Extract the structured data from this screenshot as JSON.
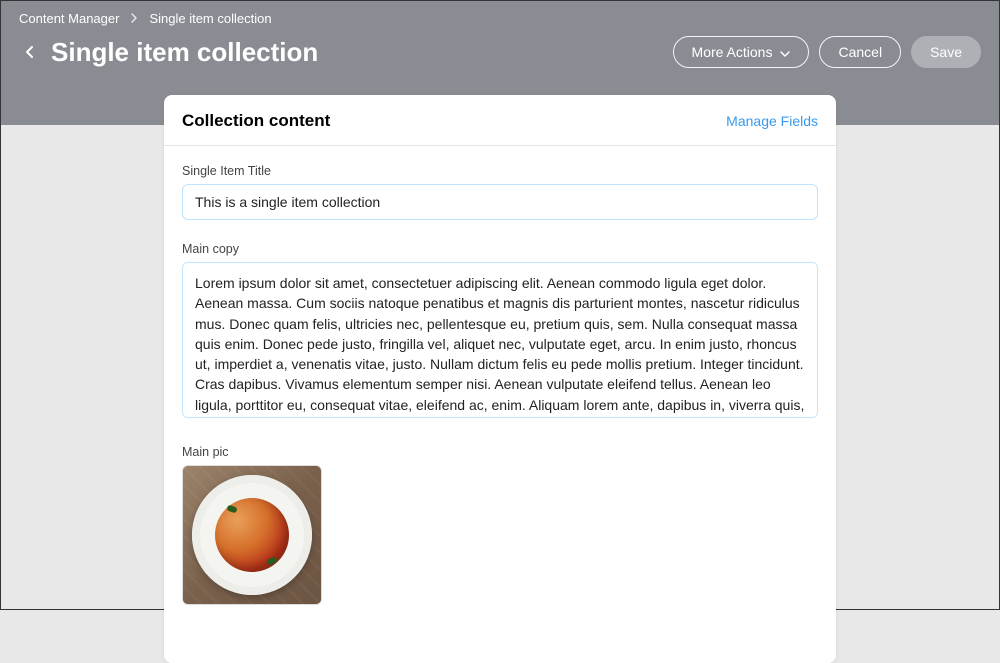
{
  "breadcrumb": {
    "root": "Content Manager",
    "current": "Single item collection"
  },
  "page_title": "Single item collection",
  "actions": {
    "more": "More Actions",
    "cancel": "Cancel",
    "save": "Save"
  },
  "card": {
    "title": "Collection content",
    "manage_link": "Manage Fields"
  },
  "fields": {
    "title": {
      "label": "Single Item Title",
      "value": "This is a single item collection"
    },
    "main_copy": {
      "label": "Main copy",
      "value": "Lorem ipsum dolor sit amet, consectetuer adipiscing elit. Aenean commodo ligula eget dolor. Aenean massa. Cum sociis natoque penatibus et magnis dis parturient montes, nascetur ridiculus mus. Donec quam felis, ultricies nec, pellentesque eu, pretium quis, sem. Nulla consequat massa quis enim. Donec pede justo, fringilla vel, aliquet nec, vulputate eget, arcu. In enim justo, rhoncus ut, imperdiet a, venenatis vitae, justo. Nullam dictum felis eu pede mollis pretium. Integer tincidunt. Cras dapibus. Vivamus elementum semper nisi. Aenean vulputate eleifend tellus. Aenean leo ligula, porttitor eu, consequat vitae, eleifend ac, enim. Aliquam lorem ante, dapibus in, viverra quis, feugiat a, tellus. Phasellus viverra nulla ut me"
    },
    "main_pic": {
      "label": "Main pic",
      "alt": "pasta-dish"
    }
  }
}
